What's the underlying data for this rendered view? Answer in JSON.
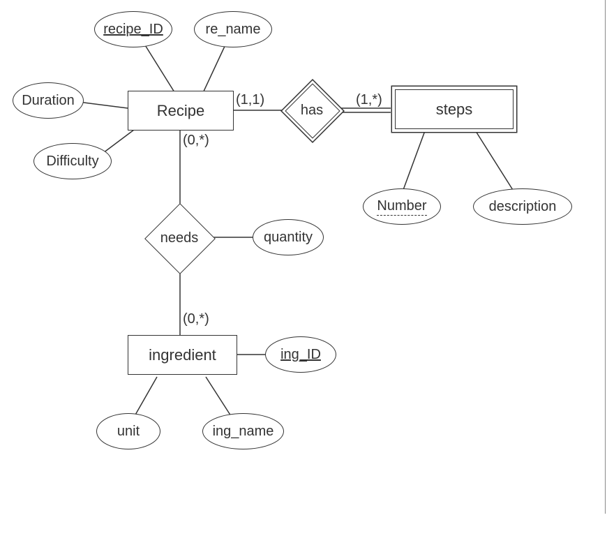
{
  "entities": {
    "recipe": {
      "label": "Recipe",
      "weak": false
    },
    "steps": {
      "label": "steps",
      "weak": true
    },
    "ingredient": {
      "label": "ingredient",
      "weak": false
    }
  },
  "relationships": {
    "has": {
      "label": "has",
      "identifying": true
    },
    "needs": {
      "label": "needs",
      "identifying": false
    }
  },
  "attributes": {
    "recipe_ID": {
      "label": "recipe_ID",
      "key": "primary"
    },
    "re_name": {
      "label": "re_name",
      "key": null
    },
    "duration": {
      "label": "Duration",
      "key": null
    },
    "difficulty": {
      "label": "Difficulty",
      "key": null
    },
    "quantity": {
      "label": "quantity",
      "key": null
    },
    "ing_ID": {
      "label": "ing_ID",
      "key": "primary"
    },
    "unit": {
      "label": "unit",
      "key": null
    },
    "ing_name": {
      "label": "ing_name",
      "key": null
    },
    "number": {
      "label": "Number",
      "key": "partial"
    },
    "description": {
      "label": "description",
      "key": null
    }
  },
  "cardinalities": {
    "recipe_has": "(1,1)",
    "has_steps": "(1,*)",
    "recipe_needs": "(0,*)",
    "needs_ingredient": "(0,*)"
  }
}
